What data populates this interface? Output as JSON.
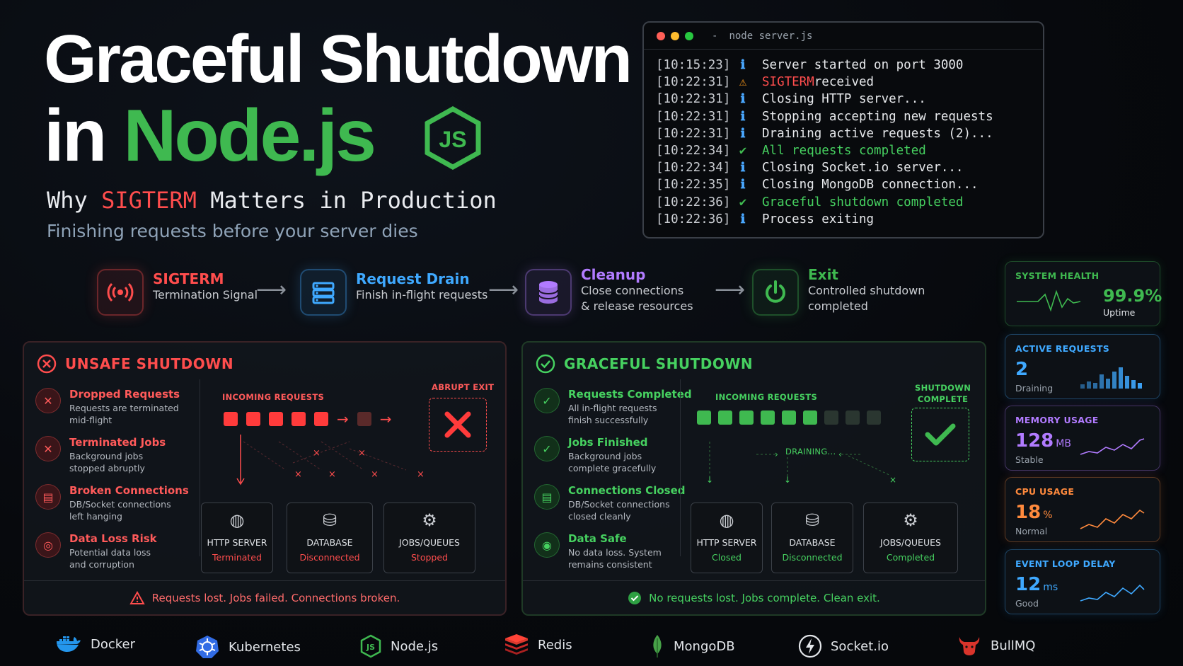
{
  "title": {
    "line1": "Graceful Shutdown",
    "line2_prefix": "in ",
    "line2_accent": "Node.js",
    "logo_text": "JS"
  },
  "subtitle": {
    "prefix": "Why ",
    "accent": "SIGTERM",
    "suffix": " Matters in Production"
  },
  "tagline": "Finishing requests before your server dies",
  "terminal": {
    "command": "node server.js",
    "separator": "-",
    "lines": [
      {
        "ts": "[10:15:23]",
        "icon": "info",
        "pre": "Server started on port 3000",
        "hl": "",
        "post": ""
      },
      {
        "ts": "[10:22:31]",
        "icon": "warn",
        "pre": "",
        "hl": "SIGTERM",
        "post": " received"
      },
      {
        "ts": "[10:22:31]",
        "icon": "info",
        "pre": "Closing HTTP server...",
        "hl": "",
        "post": ""
      },
      {
        "ts": "[10:22:31]",
        "icon": "info",
        "pre": "Stopping accepting new requests",
        "hl": "",
        "post": ""
      },
      {
        "ts": "[10:22:31]",
        "icon": "info",
        "pre": "Draining active requests (2)...",
        "hl": "",
        "post": ""
      },
      {
        "ts": "[10:22:34]",
        "icon": "check",
        "pre": "",
        "hl_green": "All requests completed",
        "post": ""
      },
      {
        "ts": "[10:22:34]",
        "icon": "info",
        "pre": "Closing Socket.io server...",
        "hl": "",
        "post": ""
      },
      {
        "ts": "[10:22:35]",
        "icon": "info",
        "pre": "Closing MongoDB connection...",
        "hl": "",
        "post": ""
      },
      {
        "ts": "[10:22:36]",
        "icon": "badge",
        "pre": "",
        "hl_green": "Graceful shutdown completed",
        "post": ""
      },
      {
        "ts": "[10:22:36]",
        "icon": "info",
        "pre": "Process exiting",
        "hl": "",
        "post": ""
      }
    ]
  },
  "flow": [
    {
      "title": "SIGTERM",
      "sub": [
        "Termination Signal"
      ],
      "color": "#ff4d4d",
      "icon": "broadcast-icon"
    },
    {
      "title": "Request Drain",
      "sub": [
        "Finish in-flight requests"
      ],
      "color": "#3fa9ff",
      "icon": "list-icon"
    },
    {
      "title": "Cleanup",
      "sub": [
        "Close connections",
        "& release resources"
      ],
      "color": "#b17bff",
      "icon": "database-icon"
    },
    {
      "title": "Exit",
      "sub": [
        "Controlled shutdown",
        "completed"
      ],
      "color": "#3fb950",
      "icon": "power-icon"
    }
  ],
  "unsafe": {
    "heading": "UNSAFE SHUTDOWN",
    "items": [
      {
        "title": "Dropped Requests",
        "desc": [
          "Requests are terminated",
          "mid-flight"
        ]
      },
      {
        "title": "Terminated Jobs",
        "desc": [
          "Background jobs",
          "stopped abruptly"
        ]
      },
      {
        "title": "Broken Connections",
        "desc": [
          "DB/Socket connections",
          "left hanging"
        ]
      },
      {
        "title": "Data Loss Risk",
        "desc": [
          "Potential data loss",
          "and corruption"
        ]
      }
    ],
    "incoming_label": "INCOMING REQUESTS",
    "exit_label": "ABRUPT EXIT",
    "services": [
      {
        "name": "HTTP SERVER",
        "status": "Terminated"
      },
      {
        "name": "DATABASE",
        "status": "Disconnected"
      },
      {
        "name": "JOBS/QUEUES",
        "status": "Stopped"
      }
    ],
    "footer": "Requests lost. Jobs failed. Connections broken."
  },
  "graceful": {
    "heading": "GRACEFUL SHUTDOWN",
    "items": [
      {
        "title": "Requests Completed",
        "desc": [
          "All in-flight requests",
          "finish successfully"
        ]
      },
      {
        "title": "Jobs Finished",
        "desc": [
          "Background jobs",
          "complete gracefully"
        ]
      },
      {
        "title": "Connections Closed",
        "desc": [
          "DB/Socket connections",
          "closed cleanly"
        ]
      },
      {
        "title": "Data Safe",
        "desc": [
          "No data loss. System",
          "remains consistent"
        ]
      }
    ],
    "incoming_label": "INCOMING REQUESTS",
    "draining_label": "DRAINING...",
    "complete_label": [
      "SHUTDOWN",
      "COMPLETE"
    ],
    "services": [
      {
        "name": "HTTP SERVER",
        "status": "Closed"
      },
      {
        "name": "DATABASE",
        "status": "Disconnected"
      },
      {
        "name": "JOBS/QUEUES",
        "status": "Completed"
      }
    ],
    "footer": "No requests lost. Jobs complete. Clean exit."
  },
  "metrics": [
    {
      "title": "SYSTEM HEALTH",
      "value": "99.9%",
      "unit": "",
      "sub": "Uptime",
      "color": "#3fb950"
    },
    {
      "title": "ACTIVE REQUESTS",
      "value": "2",
      "unit": "",
      "sub": "Draining",
      "color": "#3fa9ff"
    },
    {
      "title": "MEMORY USAGE",
      "value": "128",
      "unit": "MB",
      "sub": "Stable",
      "color": "#b17bff"
    },
    {
      "title": "CPU USAGE",
      "value": "18",
      "unit": "%",
      "sub": "Normal",
      "color": "#ff8a3d"
    },
    {
      "title": "EVENT LOOP DELAY",
      "value": "12",
      "unit": "ms",
      "sub": "Good",
      "color": "#3fa9ff"
    }
  ],
  "logos": [
    "Docker",
    "Kubernetes",
    "Node.js",
    "Redis",
    "MongoDB",
    "Socket.io",
    "BullMQ"
  ]
}
